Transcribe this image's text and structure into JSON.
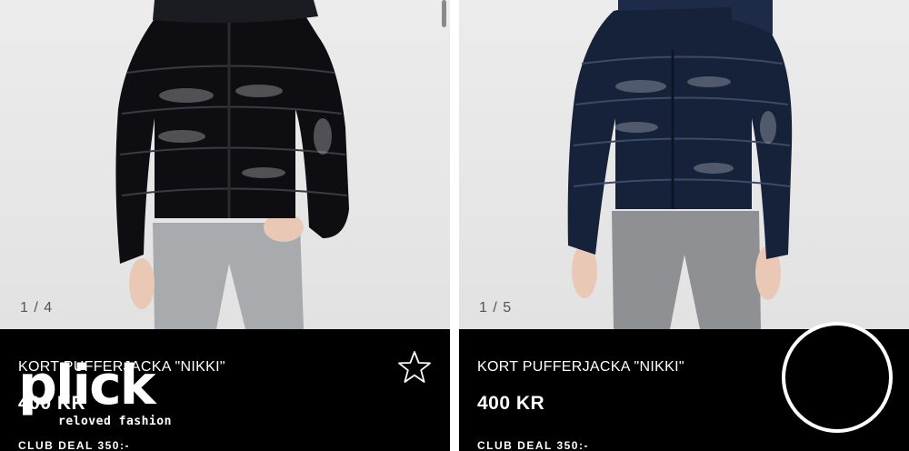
{
  "listings": [
    {
      "image_counter": "1 / 4",
      "title": "KORT PUFFERJACKA \"NIKKI\"",
      "price": "400 KR",
      "club_deal": "CLUB DEAL 350:-",
      "jacket_color": "#0e0e12",
      "favorite_icon": "star-outline-icon"
    },
    {
      "image_counter": "1 / 5",
      "title": "KORT PUFFERJACKA \"NIKKI\"",
      "price": "400 KR",
      "club_deal": "CLUB DEAL 350:-",
      "jacket_color": "#16223a"
    }
  ],
  "watermark": {
    "brand": "plick",
    "tagline": "reloved fashion"
  }
}
